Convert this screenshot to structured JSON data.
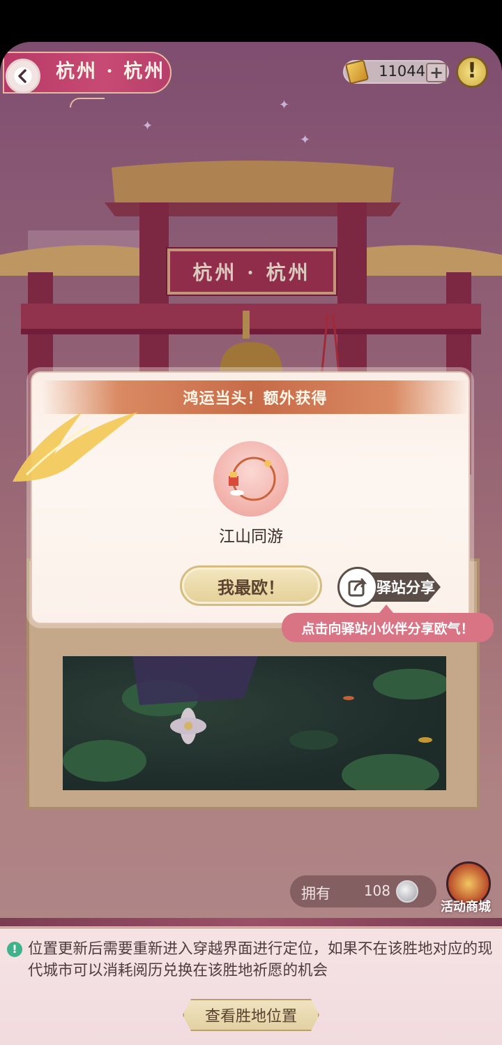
{
  "header": {
    "location_title": "杭州 · 杭州",
    "currency_count": "11044",
    "add_label": "+",
    "alert_label": "!"
  },
  "scene": {
    "gate_plaque": "杭州 · 杭州"
  },
  "modal": {
    "banner": "鸿运当头！额外获得",
    "reward_name": "江山同游",
    "ok_button": "我最欧！",
    "share_button": "驿站分享",
    "share_tooltip": "点击向驿站小伙伴分享欧气！"
  },
  "footer": {
    "own_label": "拥有",
    "own_count": "108",
    "shop_label": "活动商城",
    "notice": "位置更新后需要重新进入穿越界面进行定位，如果不在该胜地对应的现代城市可以消耗阅历兑换在该胜地祈愿的机会",
    "notice_icon": "!",
    "view_location_button": "查看胜地位置"
  },
  "colors": {
    "accent_pink": "#d97485",
    "banner_orange": "#c86b48",
    "button_gold": "#e4cf96"
  }
}
